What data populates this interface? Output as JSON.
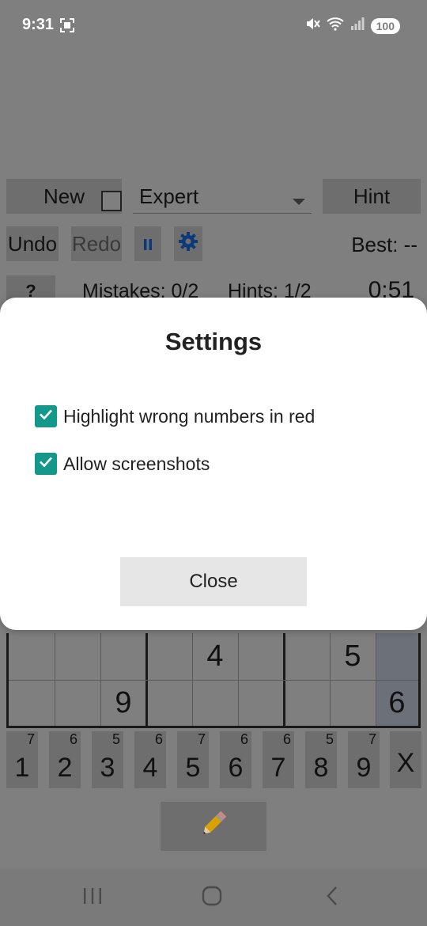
{
  "status_bar": {
    "time": "9:31",
    "battery": "100"
  },
  "toolbar": {
    "new_label": "New",
    "difficulty": "Expert",
    "hint_label": "Hint",
    "undo_label": "Undo",
    "redo_label": "Redo",
    "best": "Best: --"
  },
  "stats": {
    "help_label": "?",
    "mistakes": "Mistakes: 0/2",
    "hints": "Hints: 1/2",
    "timer": "0:51"
  },
  "grid": {
    "cells": [
      {
        "row": 0,
        "col": 4,
        "value": "4"
      },
      {
        "row": 0,
        "col": 7,
        "value": "5"
      },
      {
        "row": 1,
        "col": 2,
        "value": "9"
      },
      {
        "row": 1,
        "col": 8,
        "value": "6"
      }
    ]
  },
  "keypad": [
    {
      "digit": "1",
      "remaining": "7"
    },
    {
      "digit": "2",
      "remaining": "6"
    },
    {
      "digit": "3",
      "remaining": "5"
    },
    {
      "digit": "4",
      "remaining": "6"
    },
    {
      "digit": "5",
      "remaining": "7"
    },
    {
      "digit": "6",
      "remaining": "6"
    },
    {
      "digit": "7",
      "remaining": "6"
    },
    {
      "digit": "8",
      "remaining": "5"
    },
    {
      "digit": "9",
      "remaining": "7"
    }
  ],
  "erase_label": "X",
  "pencil_icon": "pencil-icon",
  "dialog": {
    "title": "Settings",
    "options": [
      {
        "label": "Highlight wrong numbers in red",
        "checked": true
      },
      {
        "label": "Allow screenshots",
        "checked": true
      }
    ],
    "close_label": "Close"
  },
  "colors": {
    "accent": "#13988a",
    "scrim": "#7f7f7f",
    "icon_blue": "#0d3a78"
  }
}
